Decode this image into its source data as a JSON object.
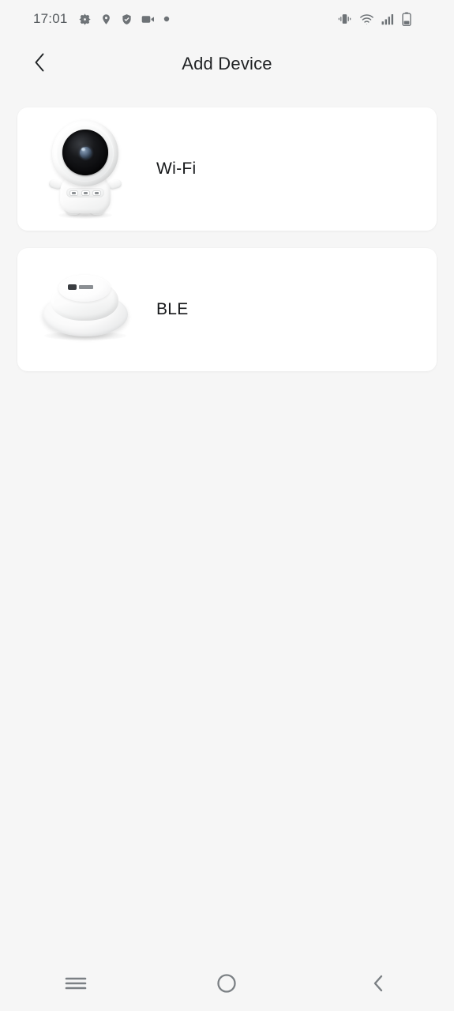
{
  "status_bar": {
    "time": "17:01",
    "left_icons": [
      {
        "name": "settings-gear-icon"
      },
      {
        "name": "location-pin-icon"
      },
      {
        "name": "shield-check-icon"
      },
      {
        "name": "video-camera-icon"
      },
      {
        "name": "dot-indicator-icon"
      }
    ],
    "right_icons": [
      {
        "name": "vibrate-icon"
      },
      {
        "name": "wifi-icon"
      },
      {
        "name": "cellular-signal-icon"
      },
      {
        "name": "battery-icon"
      }
    ],
    "colors": {
      "icon": "#6d7276",
      "time_text": "#555a5e"
    }
  },
  "header": {
    "title": "Add Device",
    "back_icon": "chevron-left-icon"
  },
  "main": {
    "options": [
      {
        "label": "Wi-Fi",
        "artwork": "robot-camera-device-image"
      },
      {
        "label": "BLE",
        "artwork": "dome-sensor-device-image"
      }
    ]
  },
  "nav_bar": {
    "buttons": [
      {
        "name": "recents-button",
        "icon": "menu-lines-icon"
      },
      {
        "name": "home-button",
        "icon": "circle-icon"
      },
      {
        "name": "back-button",
        "icon": "chevron-left-icon"
      }
    ],
    "color": "#7b8084"
  },
  "theme": {
    "page_background": "#f6f6f6",
    "card_background": "#ffffff",
    "title_text": "#1f2123",
    "label_text": "#17191b"
  }
}
